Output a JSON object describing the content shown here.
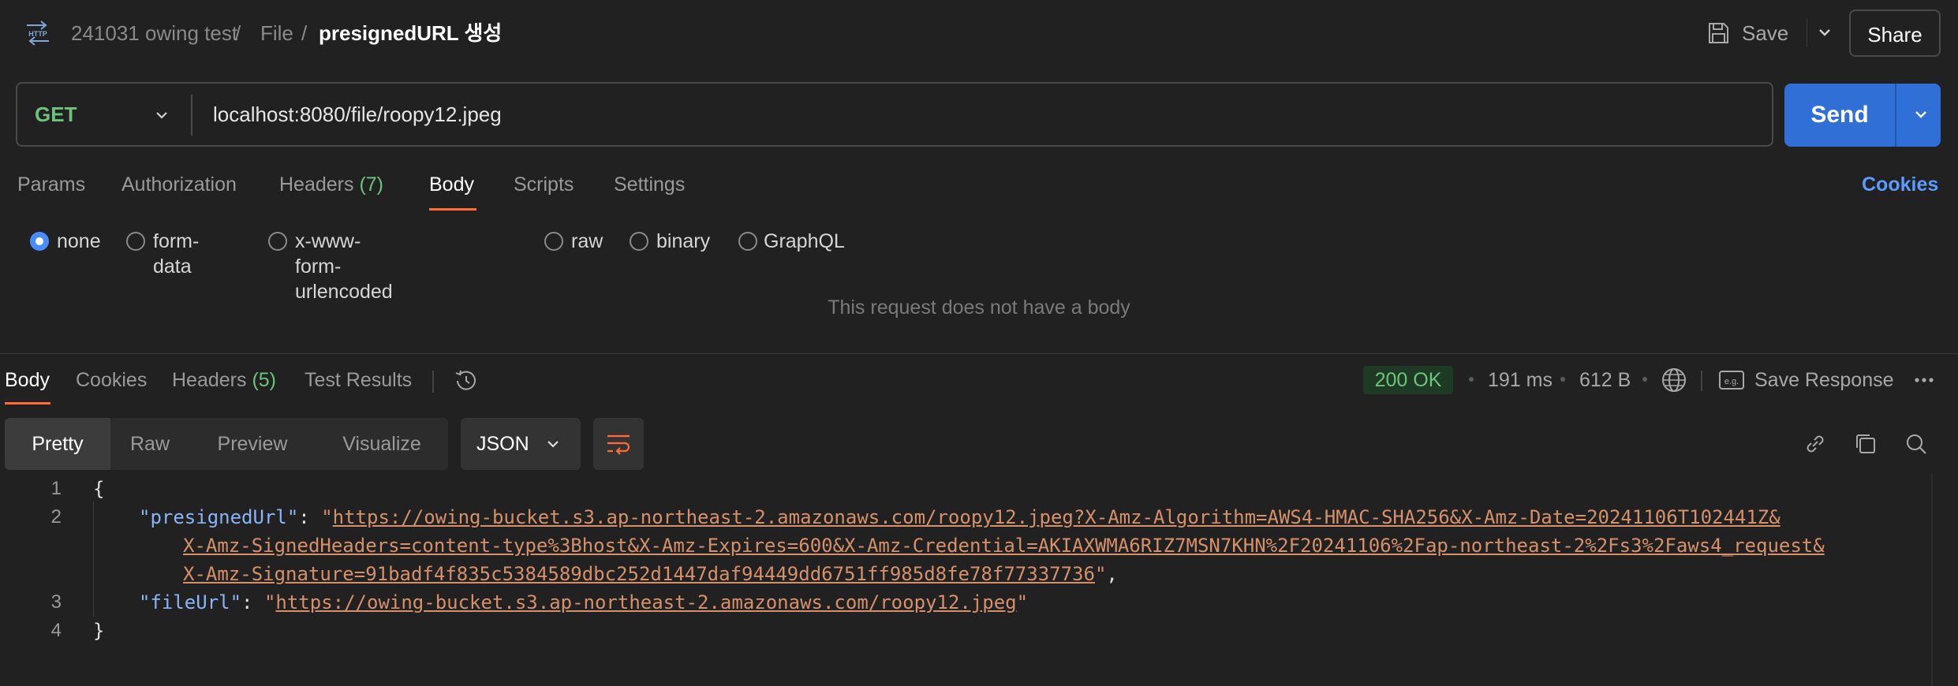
{
  "header": {
    "breadcrumb": [
      "241031 owing test",
      "File"
    ],
    "separator": "/",
    "title": "presignedURL 생성",
    "save_label": "Save",
    "share_label": "Share"
  },
  "request": {
    "method": "GET",
    "url": "localhost:8080/file/roopy12.jpeg",
    "send_label": "Send",
    "tabs": [
      {
        "label": "Params",
        "count": ""
      },
      {
        "label": "Authorization",
        "count": ""
      },
      {
        "label": "Headers",
        "count": "(7)"
      },
      {
        "label": "Body",
        "count": ""
      },
      {
        "label": "Scripts",
        "count": ""
      },
      {
        "label": "Settings",
        "count": ""
      }
    ],
    "active_tab": "Body",
    "cookies_label": "Cookies",
    "body_types": [
      "none",
      "form-data",
      "x-www-form-urlencoded",
      "raw",
      "binary",
      "GraphQL"
    ],
    "selected_body_type": "none",
    "empty_message": "This request does not have a body"
  },
  "response": {
    "tabs": [
      {
        "label": "Body",
        "count": ""
      },
      {
        "label": "Cookies",
        "count": ""
      },
      {
        "label": "Headers",
        "count": "(5)"
      },
      {
        "label": "Test Results",
        "count": ""
      }
    ],
    "active_tab": "Body",
    "status": "200 OK",
    "time": "191 ms",
    "size": "612 B",
    "save_response_label": "Save Response",
    "formats": [
      "Pretty",
      "Raw",
      "Preview",
      "Visualize"
    ],
    "active_format": "Pretty",
    "language": "JSON",
    "code": {
      "line_numbers": [
        "1",
        "2",
        "3",
        "4"
      ],
      "open_brace": "{",
      "close_brace": "}",
      "presigned_key": "\"presignedUrl\"",
      "presigned_url_part1": "https://owing-bucket.s3.ap-northeast-2.amazonaws.com/roopy12.jpeg?X-Amz-Algorithm=AWS4-HMAC-SHA256&X-Amz-Date=20241106T102441Z&",
      "presigned_url_part2": "X-Amz-SignedHeaders=content-type%3Bhost&X-Amz-Expires=600&X-Amz-Credential=AKIAXWMA6RIZ7MSN7KHN%2F20241106%2Fap-northeast-2%2Fs3%2Faws4_request&",
      "presigned_url_part3": "X-Amz-Signature=91badf4f835c5384589dbc252d1447daf94449dd6751ff985d8fe78f77337736",
      "file_key": "\"fileUrl\"",
      "file_url": "https://owing-bucket.s3.ap-northeast-2.amazonaws.com/roopy12.jpeg"
    }
  },
  "colors": {
    "accent_orange": "#ff6c37",
    "send_blue": "#2f6fd6",
    "method_green": "#6cc47a",
    "link_blue": "#5b9bff"
  },
  "icons": [
    "http-icon",
    "save-icon",
    "chevron-down-icon",
    "history-icon",
    "globe-icon",
    "example-icon",
    "more-icon",
    "wrap-icon",
    "link-icon",
    "copy-icon",
    "search-icon"
  ]
}
